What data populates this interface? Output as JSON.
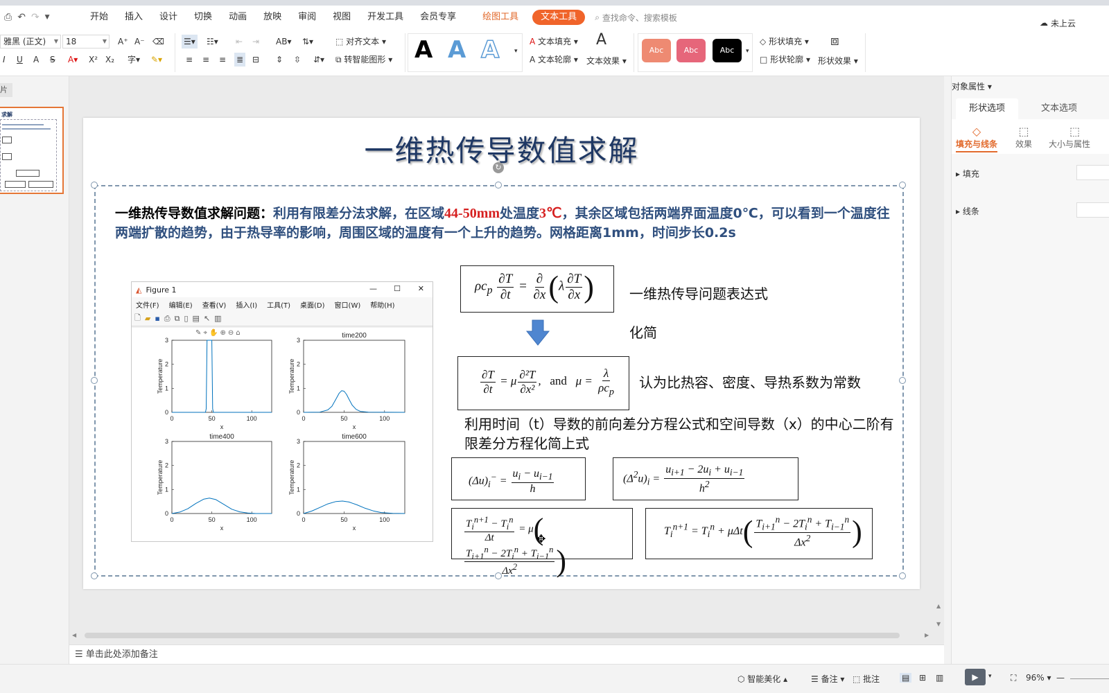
{
  "menubar": {
    "items": [
      "开始",
      "插入",
      "设计",
      "切换",
      "动画",
      "放映",
      "审阅",
      "视图",
      "开发工具",
      "会员专享"
    ],
    "drawing_tools": "绘图工具",
    "text_tools": "文本工具",
    "search_placeholder": "查找命令、搜索模板",
    "cloud_status": "未上云"
  },
  "ribbon": {
    "font_name": "雅黑 (正文)",
    "font_size": "18",
    "align_text": "对齐文本",
    "smart_shape": "转智能图形",
    "text_fill": "文本填充",
    "text_outline": "文本轮廓",
    "text_effect": "文本效果",
    "shape_fill": "形状填充",
    "shape_outline": "形状轮廓",
    "shape_effect": "形状效果",
    "style_letter": "A",
    "swatch_label": "Abc",
    "colors": {
      "accent": "#f0642a",
      "swatch1": "#ee8a72",
      "swatch2": "#e6667a",
      "swatch3": "#000000",
      "blueA": "#5b9bd5"
    }
  },
  "leftpane": {
    "tab_label": "片",
    "thumb_title": "求解"
  },
  "slide": {
    "title": "一维热传导数值求解",
    "intro": {
      "lead": "一维热传导数值求解问题：",
      "p1": "利用有限差分法求解，在区域",
      "r1": "44-50mm",
      "p2": "处温度",
      "r2": "3℃",
      "p3": "，其余区域包括两端界面温度0℃，可以看到一个温度往两端扩散的趋势，由于热导率的影响，周围区域的温度有一个上升的趋势。网格距离1mm，时间步长0.2s"
    },
    "labels": {
      "expression": "一维热传导问题表达式",
      "simplify": "化简",
      "constants": "认为比热容、密度、导热系数为常数",
      "method": "利用时间（t）导数的前向差分方程公式和空间导数（x）的中心二阶有限差分方程化简上式"
    }
  },
  "figure": {
    "window_title": "Figure 1",
    "menu": [
      "文件(F)",
      "编辑(E)",
      "查看(V)",
      "插入(I)",
      "工具(T)",
      "桌面(D)",
      "窗口(W)",
      "帮助(H)"
    ],
    "window_controls": {
      "minimize": "—",
      "maximize": "☐",
      "close": "✕"
    }
  },
  "chart_data": [
    {
      "type": "line",
      "title": "",
      "xlabel": "x",
      "ylabel": "Temperature",
      "xlim": [
        0,
        125
      ],
      "ylim": [
        0,
        3
      ],
      "xticks": [
        0,
        50,
        100
      ],
      "yticks": [
        0,
        1,
        2,
        3
      ],
      "series": [
        {
          "x": [
            0,
            42,
            43,
            44,
            50,
            51,
            52,
            125
          ],
          "y": [
            0,
            0,
            0.15,
            3,
            3,
            0.15,
            0,
            0
          ]
        }
      ]
    },
    {
      "type": "line",
      "title": "time200",
      "xlabel": "x",
      "ylabel": "Temperature",
      "xlim": [
        0,
        125
      ],
      "ylim": [
        0,
        3
      ],
      "xticks": [
        0,
        50,
        100
      ],
      "yticks": [
        0,
        1,
        2,
        3
      ],
      "series": [
        {
          "x": [
            0,
            20,
            30,
            35,
            40,
            44,
            47,
            50,
            53,
            56,
            60,
            65,
            70,
            80,
            125
          ],
          "y": [
            0,
            0.01,
            0.1,
            0.25,
            0.55,
            0.8,
            0.9,
            0.88,
            0.75,
            0.55,
            0.3,
            0.12,
            0.04,
            0.01,
            0
          ]
        }
      ]
    },
    {
      "type": "line",
      "title": "time400",
      "xlabel": "x",
      "ylabel": "Temperature",
      "xlim": [
        0,
        125
      ],
      "ylim": [
        0,
        3
      ],
      "xticks": [
        0,
        50,
        100
      ],
      "yticks": [
        0,
        1,
        2,
        3
      ],
      "series": [
        {
          "x": [
            0,
            10,
            20,
            30,
            40,
            47,
            55,
            65,
            75,
            85,
            95,
            105,
            125
          ],
          "y": [
            0,
            0.06,
            0.2,
            0.42,
            0.6,
            0.64,
            0.58,
            0.38,
            0.18,
            0.07,
            0.02,
            0,
            0
          ]
        }
      ]
    },
    {
      "type": "line",
      "title": "time600",
      "xlabel": "x",
      "ylabel": "Temperature",
      "xlim": [
        0,
        125
      ],
      "ylim": [
        0,
        3
      ],
      "xticks": [
        0,
        50,
        100
      ],
      "yticks": [
        0,
        1,
        2,
        3
      ],
      "series": [
        {
          "x": [
            0,
            10,
            20,
            30,
            40,
            48,
            56,
            66,
            76,
            86,
            96,
            110,
            125
          ],
          "y": [
            0,
            0.1,
            0.25,
            0.4,
            0.5,
            0.52,
            0.48,
            0.36,
            0.22,
            0.11,
            0.04,
            0.01,
            0
          ]
        }
      ]
    }
  ],
  "rightpane": {
    "header": "对象属性",
    "tabs": [
      "形状选项",
      "文本选项"
    ],
    "subtabs": [
      "填充与线条",
      "效果",
      "大小与属性"
    ],
    "sections": [
      "填充",
      "线条"
    ]
  },
  "notes_placeholder": "单击此处添加备注",
  "statusbar": {
    "beautify": "智能美化",
    "notes": "备注",
    "comments": "批注",
    "zoom": "96%"
  }
}
